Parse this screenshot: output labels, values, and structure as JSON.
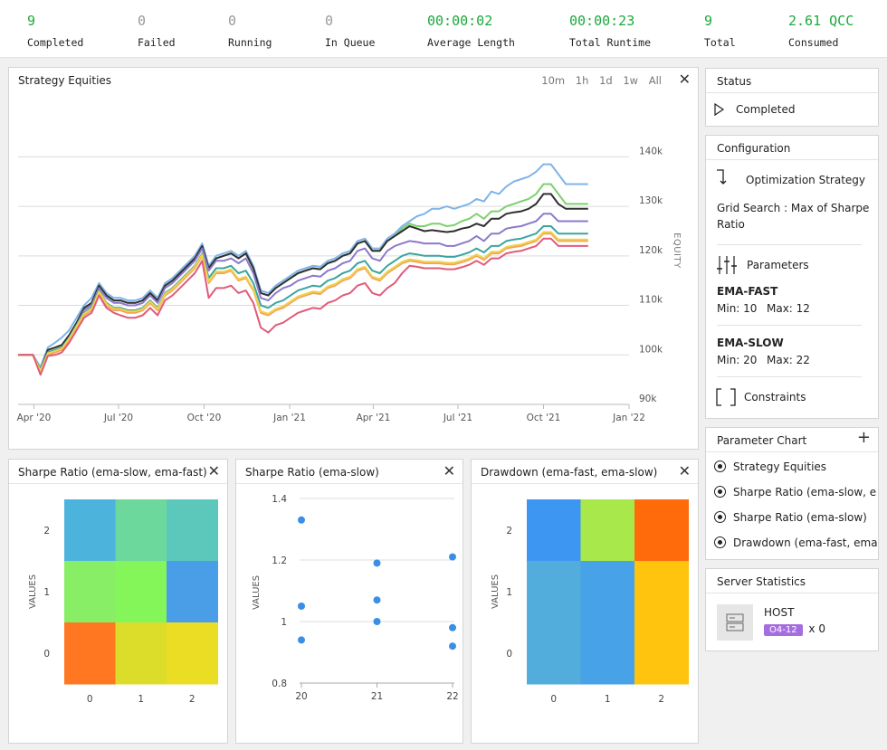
{
  "stats": [
    {
      "value": "9",
      "label": "Completed",
      "color": "#1aaa3c"
    },
    {
      "value": "0",
      "label": "Failed",
      "color": "#999999"
    },
    {
      "value": "0",
      "label": "Running",
      "color": "#999999"
    },
    {
      "value": "0",
      "label": "In Queue",
      "color": "#999999"
    },
    {
      "value": "00:00:02",
      "label": "Average Length",
      "color": "#1aaa3c"
    },
    {
      "value": "00:00:23",
      "label": "Total Runtime",
      "color": "#1aaa3c"
    },
    {
      "value": "9",
      "label": "Total",
      "color": "#1aaa3c"
    },
    {
      "value": "2.61 QCC",
      "label": "Consumed",
      "color": "#1aaa3c"
    }
  ],
  "equity_panel": {
    "title": "Strategy Equities",
    "ranges": [
      "10m",
      "1h",
      "1d",
      "1w",
      "All"
    ],
    "close": "✕"
  },
  "sharpe_heat_panel": {
    "title": "Sharpe Ratio (ema-slow, ema-fast)",
    "close": "✕"
  },
  "sharpe_scatter_panel": {
    "title": "Sharpe Ratio (ema-slow)",
    "close": "✕"
  },
  "drawdown_panel": {
    "title": "Drawdown (ema-fast, ema-slow)",
    "close": "✕"
  },
  "status": {
    "title": "Status",
    "value": "Completed",
    "icon": "play-outline-icon"
  },
  "configuration": {
    "title": "Configuration",
    "strategy_label": "Optimization Strategy",
    "strategy_line1": "Grid Search : Max of Sharpe",
    "strategy_line2": "Ratio",
    "parameters_label": "Parameters",
    "params": [
      {
        "name": "EMA-FAST",
        "min_label": "Min: 10",
        "max_label": "Max: 12"
      },
      {
        "name": "EMA-SLOW",
        "min_label": "Min: 20",
        "max_label": "Max: 22"
      }
    ],
    "constraints_label": "Constraints"
  },
  "parameter_chart": {
    "title": "Parameter Chart",
    "add": "+",
    "items": [
      "Strategy Equities",
      "Sharpe Ratio (ema-slow, e",
      "Sharpe Ratio (ema-slow)",
      "Drawdown (ema-fast, ema"
    ]
  },
  "server_stats": {
    "title": "Server Statistics",
    "host": "HOST",
    "badge": "O4-12",
    "count": "x 0"
  },
  "chart_data": [
    {
      "type": "line",
      "title": "Strategy Equities",
      "ylabel": "EQUITY",
      "ylim": [
        90000,
        145000
      ],
      "xlim": [
        "2020-03-15",
        "2022-01-01"
      ],
      "x_ticks": [
        "Apr '20",
        "Jul '20",
        "Oct '20",
        "Jan '21",
        "Apr '21",
        "Jul '21",
        "Oct '21",
        "Jan '22"
      ],
      "y_ticks": [
        "90k",
        "100k",
        "110k",
        "120k",
        "130k",
        "140k"
      ],
      "x": [
        "2020-03-15",
        "2020-03-31",
        "2020-04-08",
        "2020-04-16",
        "2020-04-24",
        "2020-05-01",
        "2020-05-09",
        "2020-05-17",
        "2020-05-25",
        "2020-06-02",
        "2020-06-10",
        "2020-06-18",
        "2020-06-26",
        "2020-07-03",
        "2020-07-11",
        "2020-07-19",
        "2020-07-27",
        "2020-08-04",
        "2020-08-12",
        "2020-08-20",
        "2020-08-28",
        "2020-09-05",
        "2020-09-13",
        "2020-09-21",
        "2020-09-29",
        "2020-10-06",
        "2020-10-14",
        "2020-10-22",
        "2020-10-30",
        "2020-11-07",
        "2020-11-15",
        "2020-11-23",
        "2020-12-01",
        "2020-12-09",
        "2020-12-17",
        "2020-12-25",
        "2021-01-02",
        "2021-01-10",
        "2021-01-18",
        "2021-01-26",
        "2021-02-03",
        "2021-02-11",
        "2021-02-19",
        "2021-02-27",
        "2021-03-07",
        "2021-03-15",
        "2021-03-23",
        "2021-03-31",
        "2021-04-08",
        "2021-04-16",
        "2021-04-24",
        "2021-05-02",
        "2021-05-10",
        "2021-05-18",
        "2021-05-26",
        "2021-06-03",
        "2021-06-11",
        "2021-06-19",
        "2021-06-27",
        "2021-07-05",
        "2021-07-13",
        "2021-07-21",
        "2021-07-29",
        "2021-08-06",
        "2021-08-14",
        "2021-08-22",
        "2021-08-30",
        "2021-09-07",
        "2021-09-15",
        "2021-09-23",
        "2021-10-01",
        "2021-10-09",
        "2021-10-17",
        "2021-10-25",
        "2021-11-02",
        "2021-11-10",
        "2021-11-18"
      ],
      "series": [
        {
          "color": "#7fb3e8",
          "values": [
            100000,
            100000,
            97500,
            101500,
            102500,
            103500,
            105000,
            107500,
            110000,
            111500,
            114500,
            112500,
            111500,
            111500,
            111000,
            111000,
            111500,
            113000,
            111500,
            114500,
            115500,
            117000,
            118500,
            120000,
            122500,
            118000,
            120000,
            120500,
            121000,
            120000,
            121000,
            118000,
            113000,
            112500,
            114000,
            115000,
            116000,
            117000,
            117500,
            118000,
            117800,
            119000,
            119500,
            120500,
            121000,
            123000,
            123500,
            121500,
            121500,
            123500,
            124500,
            126000,
            127000,
            128000,
            128500,
            129500,
            129500,
            130000,
            129500,
            130000,
            130500,
            131500,
            131000,
            133000,
            132500,
            134000,
            135000,
            135500,
            136000,
            137000,
            138500,
            138500,
            136500,
            134500,
            134500,
            134500,
            134500,
            134500,
            136000
          ]
        },
        {
          "color": "#7dd06d",
          "values": [
            100000,
            100000,
            97000,
            101000,
            101500,
            102000,
            104000,
            106500,
            109500,
            110500,
            114000,
            112000,
            111000,
            111000,
            110500,
            110500,
            111000,
            112500,
            111000,
            114000,
            115000,
            116500,
            118000,
            119500,
            122000,
            117500,
            119500,
            120000,
            120500,
            119500,
            120500,
            117500,
            112500,
            112000,
            113500,
            114500,
            115500,
            116500,
            117000,
            117500,
            117300,
            118500,
            119000,
            120000,
            120500,
            122500,
            123000,
            121000,
            121000,
            123000,
            124000,
            125500,
            126500,
            126000,
            126000,
            126500,
            126500,
            126000,
            126200,
            127000,
            127500,
            128500,
            127500,
            129000,
            129000,
            130000,
            130500,
            131000,
            131500,
            132500,
            134500,
            134500,
            132500,
            130500,
            130500,
            130500,
            130500,
            130500,
            132000
          ]
        },
        {
          "color": "#2f2f2f",
          "values": [
            100000,
            100000,
            97000,
            101000,
            101500,
            102000,
            104000,
            106500,
            109500,
            110500,
            114000,
            112000,
            111000,
            111000,
            110500,
            110500,
            111000,
            112500,
            111000,
            114000,
            115000,
            116500,
            118000,
            119500,
            122000,
            117500,
            119500,
            120000,
            120500,
            119500,
            120500,
            117500,
            112500,
            112000,
            113500,
            114500,
            115500,
            116500,
            117000,
            117500,
            117300,
            118500,
            119000,
            120000,
            120500,
            122500,
            123000,
            121000,
            121000,
            123000,
            124000,
            125000,
            126000,
            125500,
            125000,
            125200,
            125000,
            124800,
            125000,
            125500,
            125800,
            126500,
            126000,
            127500,
            127500,
            128500,
            128800,
            129000,
            129500,
            130500,
            132500,
            132500,
            130500,
            129500,
            129500,
            129500,
            129500,
            129500,
            131000
          ]
        },
        {
          "color": "#8c79cc",
          "values": [
            100000,
            100000,
            97000,
            100500,
            101000,
            101500,
            103500,
            106000,
            109000,
            110000,
            113500,
            111500,
            110500,
            110500,
            110000,
            110000,
            110500,
            112000,
            110500,
            113500,
            114500,
            116000,
            117500,
            119000,
            121500,
            117000,
            119000,
            119000,
            119500,
            118500,
            119500,
            116500,
            111500,
            111000,
            112500,
            113500,
            114000,
            115000,
            115500,
            116000,
            115800,
            117000,
            117500,
            118500,
            119000,
            121000,
            121500,
            119500,
            119000,
            121000,
            122000,
            122500,
            123000,
            122800,
            122500,
            122500,
            122500,
            122000,
            122000,
            122500,
            123000,
            124000,
            123000,
            124500,
            124500,
            125500,
            125800,
            126000,
            126500,
            127000,
            128500,
            128500,
            127000,
            127000,
            127000,
            127000,
            127000,
            127000,
            128000
          ]
        },
        {
          "color": "#3ba4a0",
          "values": [
            100000,
            100000,
            97000,
            100500,
            101000,
            101500,
            103500,
            106000,
            108500,
            109500,
            113000,
            110500,
            109500,
            109500,
            109000,
            109000,
            109500,
            111000,
            109500,
            112500,
            113500,
            115000,
            116500,
            118000,
            120500,
            115500,
            117500,
            117500,
            118000,
            116500,
            117000,
            114500,
            110000,
            109500,
            110500,
            111000,
            112000,
            113000,
            113500,
            114000,
            113800,
            115000,
            115500,
            116500,
            117000,
            118500,
            119000,
            117000,
            116500,
            118000,
            119000,
            120000,
            120500,
            120300,
            120000,
            120000,
            120000,
            119800,
            119800,
            120200,
            120700,
            121500,
            120700,
            122000,
            122000,
            123000,
            123300,
            123500,
            124000,
            124500,
            126000,
            126000,
            124500,
            124500,
            124500,
            124500,
            124500,
            124500,
            125500
          ]
        },
        {
          "color": "#f2a25a",
          "values": [
            100000,
            100000,
            96500,
            100000,
            100500,
            101000,
            103000,
            105500,
            108000,
            109000,
            112500,
            110000,
            109000,
            109000,
            108500,
            108500,
            109000,
            110500,
            109000,
            112000,
            113000,
            114500,
            116000,
            117500,
            120000,
            114500,
            116500,
            116500,
            117000,
            115000,
            115500,
            113000,
            108500,
            108000,
            109000,
            109500,
            110500,
            111500,
            112000,
            112500,
            112300,
            113500,
            114000,
            115000,
            115500,
            117000,
            117500,
            115500,
            115000,
            116500,
            117500,
            118500,
            119000,
            118800,
            118500,
            118500,
            118500,
            118300,
            118300,
            118700,
            119200,
            120000,
            119200,
            120500,
            120500,
            121500,
            121800,
            122000,
            122500,
            123000,
            124500,
            124500,
            123000,
            123000,
            123000,
            123000,
            123000,
            123000,
            124000
          ]
        },
        {
          "color": "#f0d24a",
          "values": [
            100000,
            100000,
            96800,
            100300,
            100800,
            101300,
            103300,
            105800,
            108300,
            109300,
            112800,
            110300,
            109300,
            109300,
            108800,
            108800,
            109300,
            110800,
            109300,
            112300,
            113300,
            114800,
            116300,
            117800,
            120300,
            114800,
            116800,
            116800,
            117300,
            115300,
            115800,
            113300,
            108800,
            108300,
            109300,
            109800,
            110800,
            111800,
            112300,
            112800,
            112600,
            113800,
            114300,
            115300,
            115800,
            117300,
            117800,
            115800,
            115300,
            116800,
            117800,
            118800,
            119300,
            119100,
            118800,
            118800,
            118800,
            118600,
            118600,
            119000,
            119500,
            120300,
            119500,
            120800,
            120800,
            121800,
            122100,
            122300,
            122800,
            123300,
            124800,
            124800,
            123300,
            123300,
            123300,
            123300,
            123300,
            123300,
            124300
          ]
        },
        {
          "color": "#e05b7a",
          "values": [
            100000,
            100000,
            96000,
            99800,
            100000,
            100500,
            102500,
            105000,
            107500,
            108500,
            112000,
            109500,
            108500,
            108000,
            107500,
            107500,
            108000,
            109500,
            108000,
            111000,
            112000,
            113500,
            115000,
            116500,
            119000,
            111500,
            113500,
            113500,
            114000,
            112500,
            113000,
            110500,
            105500,
            104500,
            106000,
            106500,
            107500,
            108500,
            109000,
            109500,
            109300,
            110500,
            111000,
            112000,
            112500,
            114000,
            114500,
            112500,
            112000,
            113500,
            114500,
            116500,
            118000,
            117800,
            117500,
            117500,
            117500,
            117300,
            117300,
            117700,
            118200,
            119000,
            118200,
            119500,
            119500,
            120500,
            120800,
            121000,
            121500,
            122000,
            123500,
            123500,
            122000,
            122000,
            122000,
            122000,
            122000,
            122000,
            123500
          ]
        }
      ]
    },
    {
      "type": "heatmap",
      "title": "Sharpe Ratio (ema-slow, ema-fast)",
      "ylabel": "VALUES",
      "x_ticks": [
        "0",
        "1",
        "2"
      ],
      "y_ticks": [
        "0",
        "1",
        "2"
      ],
      "rows": [
        {
          "y": "2",
          "colors": [
            "#4cb4dc",
            "#6cd89c",
            "#5cc8bc"
          ]
        },
        {
          "y": "1",
          "colors": [
            "#88ee66",
            "#84f65a",
            "#4a9ee8"
          ]
        },
        {
          "y": "0",
          "colors": [
            "#ff7720",
            "#dcdc2a",
            "#ebdc24"
          ]
        }
      ]
    },
    {
      "type": "scatter",
      "title": "Sharpe Ratio (ema-slow)",
      "ylabel": "VALUES",
      "ylim": [
        0.8,
        1.4
      ],
      "x_ticks": [
        "20",
        "21",
        "22"
      ],
      "y_ticks": [
        "0.8",
        "1",
        "1.2",
        "1.4"
      ],
      "color": "#3a8ee6",
      "points": [
        {
          "x": 20,
          "y": 1.33
        },
        {
          "x": 20,
          "y": 1.05
        },
        {
          "x": 20,
          "y": 0.94
        },
        {
          "x": 21,
          "y": 1.19
        },
        {
          "x": 21,
          "y": 1.07
        },
        {
          "x": 21,
          "y": 1.0
        },
        {
          "x": 22,
          "y": 1.21
        },
        {
          "x": 22,
          "y": 0.98
        },
        {
          "x": 22,
          "y": 0.92
        }
      ]
    },
    {
      "type": "heatmap",
      "title": "Drawdown (ema-fast, ema-slow)",
      "ylabel": "VALUES",
      "x_ticks": [
        "0",
        "1",
        "2"
      ],
      "y_ticks": [
        "0",
        "1",
        "2"
      ],
      "rows": [
        {
          "y": "2",
          "colors": [
            "#3d96f2",
            "#a8e84a",
            "#ff6a0a"
          ]
        },
        {
          "y": "1",
          "colors": [
            "#52acdc",
            "#47a2e8",
            "#ffc40e"
          ]
        },
        {
          "y": "0",
          "colors": [
            "#52acdc",
            "#47a2e8",
            "#ffc40e"
          ]
        }
      ]
    }
  ]
}
